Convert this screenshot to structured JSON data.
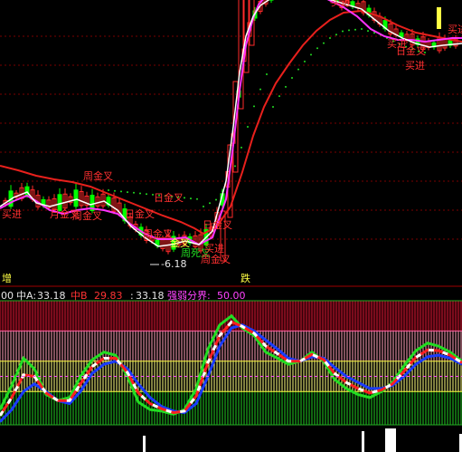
{
  "colors": {
    "background": "#000000",
    "up_candle": "#ff2a2a",
    "down_candle": "#00ff00",
    "ma_red": "#e8201c",
    "ma_white": "#ffffff",
    "ma_magenta": "#ff33ff",
    "signal_red": "#ff3030",
    "signal_yellow": "#ffff44",
    "ind_green": "#22dd22",
    "ind_blue": "#1a3cff",
    "ind_red": "#ff2020",
    "info_white": "#e6e6e6",
    "info_red": "#ff3333",
    "info_magenta": "#ff44ff"
  },
  "main_panel": {
    "low_price_label": "-6.18",
    "bottom_left_label": "增",
    "bottom_center_label": "跌",
    "annotations": [
      {
        "text": "买进",
        "color": "#ff3030"
      },
      {
        "text": "周金叉",
        "color": "#ff3030"
      },
      {
        "text": "日金叉",
        "color": "#ff3030"
      },
      {
        "text": "月金叉",
        "color": "#ff3030"
      },
      {
        "text": "周金叉",
        "color": "#ff3030"
      },
      {
        "text": "日金叉",
        "color": "#ff3030"
      },
      {
        "text": "周金叉",
        "color": "#ff3030"
      },
      {
        "text": "周死叉",
        "color": "#22dd22"
      },
      {
        "text": "金叉",
        "color": "#ffff44"
      },
      {
        "text": "买进",
        "color": "#ff3030"
      },
      {
        "text": "周金叉",
        "color": "#ff3030"
      },
      {
        "text": "日金叉",
        "color": "#ff3030"
      },
      {
        "text": "买进",
        "color": "#ff3030"
      },
      {
        "text": "买进",
        "color": "#ff3030"
      },
      {
        "text": "日金叉",
        "color": "#ff3030"
      },
      {
        "text": "买进",
        "color": "#ff3030"
      },
      {
        "text": "买进",
        "color": "#ff3030"
      }
    ]
  },
  "indicator_header": {
    "prefix": "00",
    "zhong_a_label": "中A:",
    "zhong_a_value": "33.18",
    "zhong_b_label": "中B",
    "zhong_b_value": "29.83",
    "third_label": ":",
    "third_value": "33.18",
    "strength_label": "强弱分界:",
    "strength_value": "50.00"
  },
  "chart_data": {
    "type": "line",
    "series": [
      {
        "name": "中A",
        "values": [
          28,
          44,
          62,
          55,
          38,
          34,
          36,
          50,
          61,
          66,
          64,
          50,
          33,
          28,
          27,
          25,
          28,
          42,
          68,
          84,
          90,
          82,
          77,
          66,
          62,
          58,
          60,
          66,
          60,
          48,
          42,
          38,
          36,
          40,
          46,
          57,
          67,
          72,
          70,
          66,
          60
        ]
      },
      {
        "name": "中B",
        "values": [
          20,
          28,
          40,
          45,
          40,
          34,
          32,
          40,
          52,
          58,
          60,
          55,
          45,
          36,
          30,
          27,
          26,
          32,
          50,
          70,
          82,
          84,
          80,
          74,
          68,
          62,
          60,
          63,
          62,
          56,
          50,
          46,
          42,
          42,
          44,
          50,
          58,
          63,
          64,
          62,
          58
        ]
      },
      {
        "name": "强弱分界",
        "values": [
          50
        ]
      }
    ]
  }
}
